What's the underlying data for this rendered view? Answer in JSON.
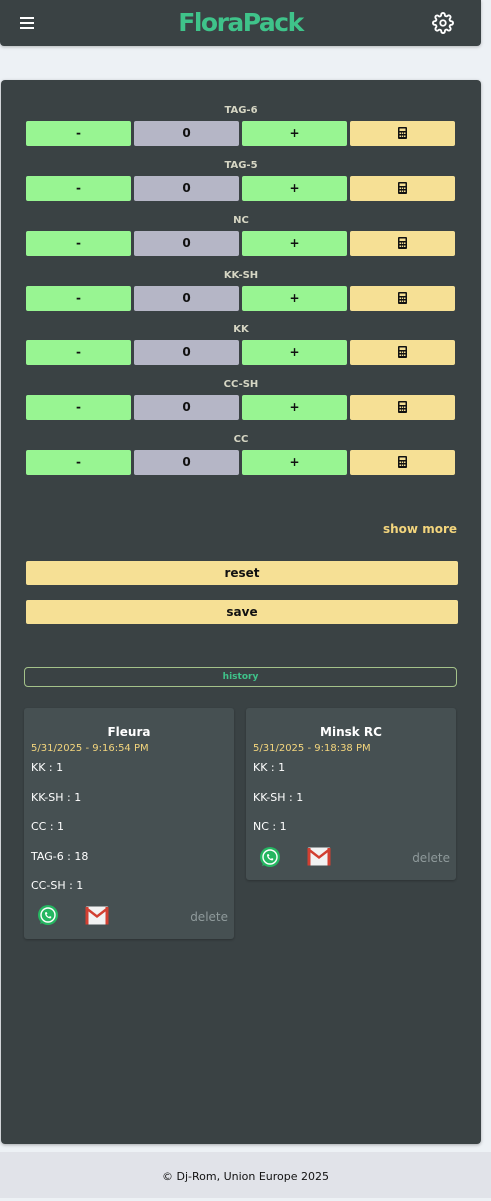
{
  "header": {
    "brand": "FloraPack",
    "brand_color": "#3fc38a",
    "menu_icon": "hamburger-menu-icon",
    "settings_icon": "gear-icon"
  },
  "counters": [
    {
      "label": "TAG-6",
      "minus": "-",
      "value": "0",
      "plus": "+",
      "calc_icon": "calculator-icon"
    },
    {
      "label": "TAG-5",
      "minus": "-",
      "value": "0",
      "plus": "+",
      "calc_icon": "calculator-icon"
    },
    {
      "label": "NC",
      "minus": "-",
      "value": "0",
      "plus": "+",
      "calc_icon": "calculator-icon"
    },
    {
      "label": "KK-SH",
      "minus": "-",
      "value": "0",
      "plus": "+",
      "calc_icon": "calculator-icon"
    },
    {
      "label": "KK",
      "minus": "-",
      "value": "0",
      "plus": "+",
      "calc_icon": "calculator-icon"
    },
    {
      "label": "CC-SH",
      "minus": "-",
      "value": "0",
      "plus": "+",
      "calc_icon": "calculator-icon"
    },
    {
      "label": "CC",
      "minus": "-",
      "value": "0",
      "plus": "+",
      "calc_icon": "calculator-icon"
    }
  ],
  "actions": {
    "show_more": "show more",
    "reset": "reset",
    "save": "save",
    "history": "history"
  },
  "history_cards": [
    {
      "title": "Fleura",
      "time": "5/31/2025 - 9:16:54 PM",
      "lines": [
        "KK : 1",
        "KK-SH : 1",
        "CC : 1",
        "TAG-6 : 18",
        "CC-SH : 1"
      ],
      "delete": "delete"
    },
    {
      "title": "Minsk RC",
      "time": "5/31/2025 - 9:18:38 PM",
      "lines": [
        "KK : 1",
        "KK-SH : 1",
        "NC : 1"
      ],
      "delete": "delete"
    }
  ],
  "footer": "© Dj-Rom, Union Europe 2025",
  "colors": {
    "panel": "#3a4244",
    "green_button": "#98f592",
    "value_box": "#b5b6c6",
    "yellow_button": "#f6e095",
    "accent_yellow": "#f3d57d"
  }
}
